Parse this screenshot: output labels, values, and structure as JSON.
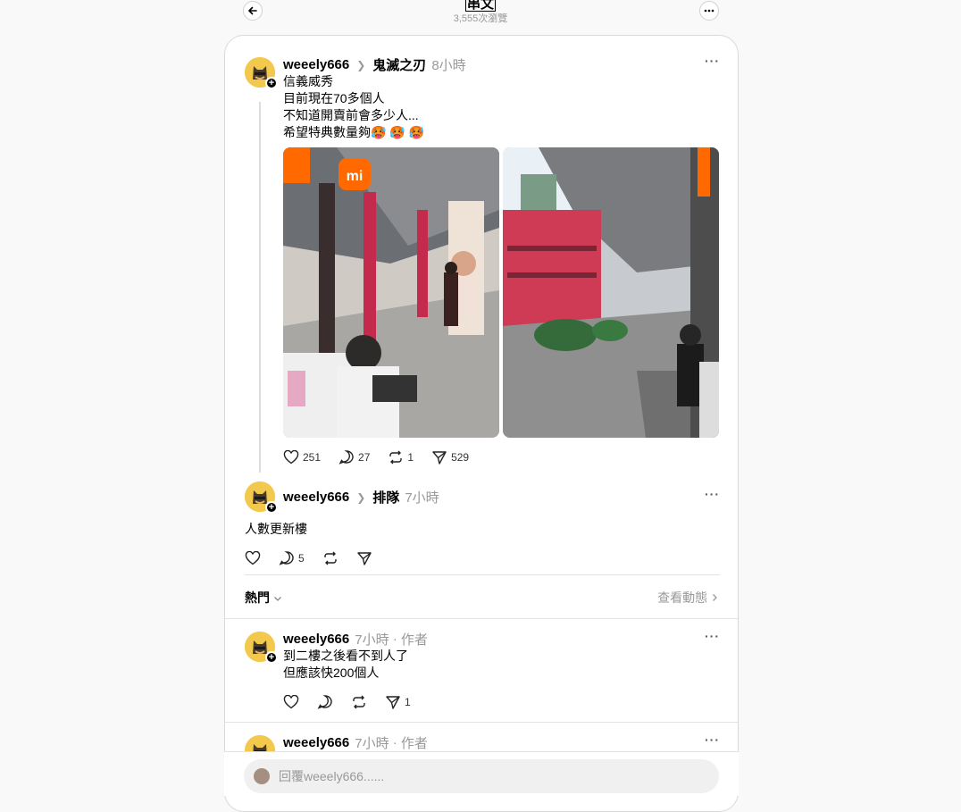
{
  "header": {
    "title": "串文",
    "views": "3,555次瀏覽",
    "back_icon": "back-arrow-icon",
    "more_icon": "more-icon"
  },
  "posts": [
    {
      "username": "weeely666",
      "topic": "鬼滅之刃",
      "time": "8小時",
      "lines": [
        "信義威秀",
        "目前現在70多個人",
        "不知道開賣前會多少人...",
        "希望特典數量夠🥵 🥵 🥵"
      ],
      "likes": "251",
      "comments": "27",
      "reposts": "1",
      "shares": "529"
    },
    {
      "username": "weeely666",
      "topic": "排隊",
      "time": "7小時",
      "lines": [
        "人數更新樓"
      ],
      "comments": "5"
    }
  ],
  "sort": {
    "label": "熱門",
    "activity": "查看動態"
  },
  "replies": [
    {
      "username": "weeely666",
      "time": "7小時",
      "author_tag": "作者",
      "lines": [
        "到二樓之後看不到人了",
        "但應該快200個人"
      ],
      "shares": "1"
    },
    {
      "username": "weeely666",
      "time": "7小時",
      "author_tag": "作者"
    }
  ],
  "reply_box": {
    "placeholder": "回覆weeely666......"
  },
  "colors": {
    "avatar": "#f2c94c",
    "brand_sign": "#ff6900"
  }
}
